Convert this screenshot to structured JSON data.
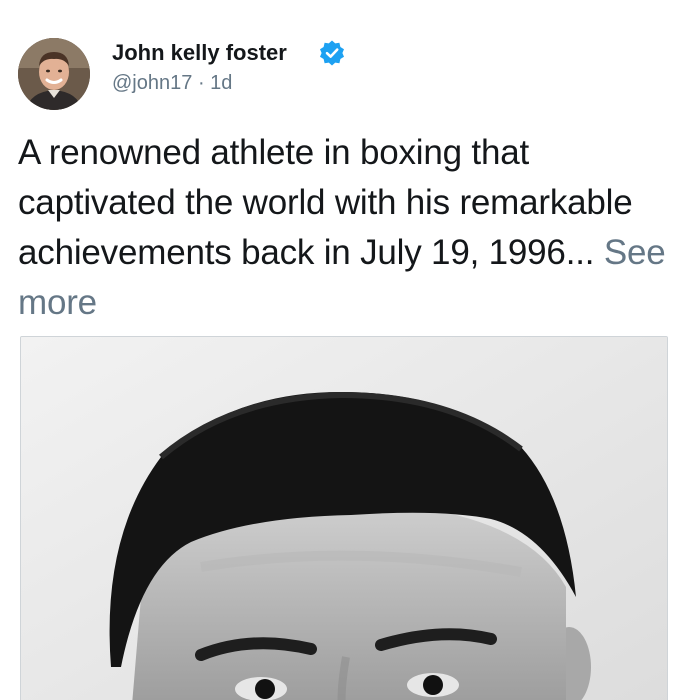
{
  "tweet": {
    "author": {
      "name": "John kelly foster",
      "verified": true,
      "handle": "@john17",
      "separator": "·",
      "time": "1d",
      "avatar_icon": "profile-photo"
    },
    "text": "A renowned athlete in boxing that captivated the world with his remarkable achievements back in July 19, 1996...",
    "see_more": "See more",
    "media": {
      "type": "photo",
      "style": "black-and-white portrait"
    }
  },
  "colors": {
    "text_primary": "#14171a",
    "text_secondary": "#657786",
    "verified_blue": "#1da1f2",
    "media_border": "#cfd4d8"
  }
}
